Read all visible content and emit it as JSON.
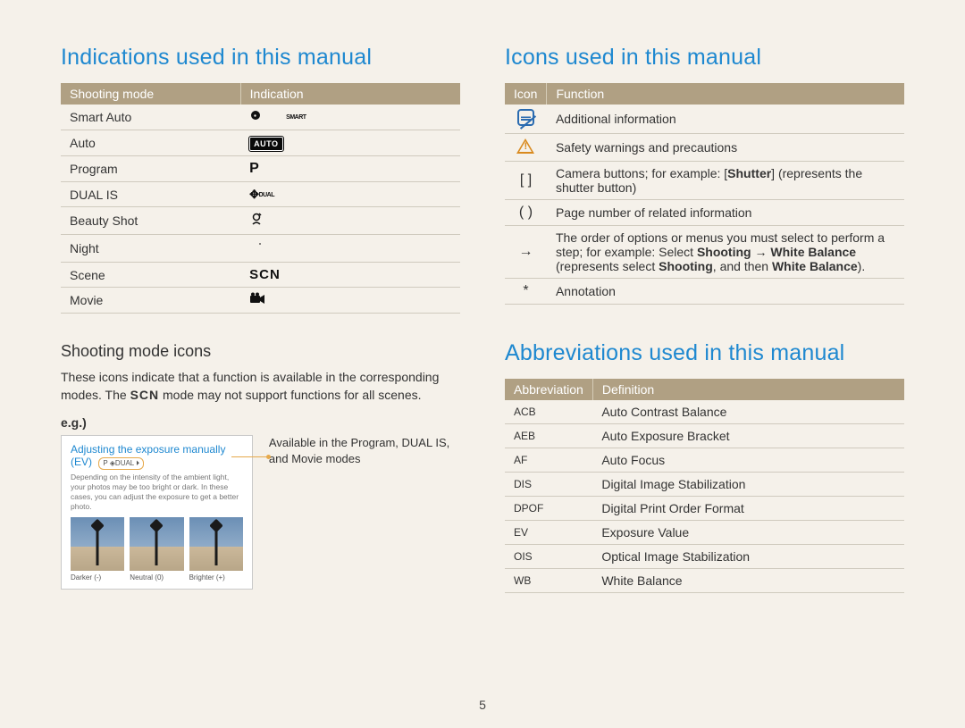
{
  "page_number": "5",
  "left": {
    "title": "Indications used in this manual",
    "table_headers": [
      "Shooting mode",
      "Indication"
    ],
    "rows": [
      {
        "mode": "Smart Auto",
        "indication_kind": "smart"
      },
      {
        "mode": "Auto",
        "indication_kind": "auto_chip",
        "indication_text": "AUTO"
      },
      {
        "mode": "Program",
        "indication_kind": "text",
        "indication_text": "P"
      },
      {
        "mode": "DUAL IS",
        "indication_kind": "dual"
      },
      {
        "mode": "Beauty Shot",
        "indication_kind": "beauty"
      },
      {
        "mode": "Night",
        "indication_kind": "night"
      },
      {
        "mode": "Scene",
        "indication_kind": "text_scn",
        "indication_text": "SCN"
      },
      {
        "mode": "Movie",
        "indication_kind": "movie"
      }
    ],
    "sub_title": "Shooting mode icons",
    "sub_desc_pre": "These icons indicate that a function is available in the corresponding modes. The ",
    "sub_desc_scn": "SCN",
    "sub_desc_post": " mode may not support functions for all scenes.",
    "eg_label": "e.g.)",
    "eg_box": {
      "title": "Adjusting the exposure manually (EV)",
      "badge": "P ◈DUAL ⏵",
      "desc": "Depending on the intensity of the ambient light, your photos may be too bright or dark. In these cases, you can adjust the exposure to get a better photo.",
      "thumbs": [
        {
          "caption": "Darker (-)"
        },
        {
          "caption": "Neutral (0)"
        },
        {
          "caption": "Brighter (+)"
        }
      ]
    },
    "eg_sidelabel": "Available in the Program, DUAL IS, and Movie modes"
  },
  "right": {
    "icons_title": "Icons used in this manual",
    "icons_headers": [
      "Icon",
      "Function"
    ],
    "icons_rows": [
      {
        "glyph": "note",
        "text": "Additional information"
      },
      {
        "glyph": "warn",
        "text": "Safety warnings and precautions"
      },
      {
        "glyph": "brackets_sq",
        "icon_text": "[ ]",
        "html": "Camera buttons; for example: [<strong>Shutter</strong>] (represents the shutter button)"
      },
      {
        "glyph": "brackets_rnd",
        "icon_text": "( )",
        "text": "Page number of related information"
      },
      {
        "glyph": "arrow",
        "icon_text": "→",
        "html": "The order of options or menus you must select to perform a step; for example: Select <strong>Shooting</strong> → <strong>White Balance</strong> (represents select <strong>Shooting</strong>, and then <strong>White Balance</strong>)."
      },
      {
        "glyph": "asterisk",
        "icon_text": "*",
        "text": "Annotation"
      }
    ],
    "abbr_title": "Abbreviations used in this manual",
    "abbr_headers": [
      "Abbreviation",
      "Definition"
    ],
    "abbr_rows": [
      {
        "abbr": "ACB",
        "def": "Auto Contrast Balance"
      },
      {
        "abbr": "AEB",
        "def": "Auto Exposure Bracket"
      },
      {
        "abbr": "AF",
        "def": "Auto Focus"
      },
      {
        "abbr": "DIS",
        "def": "Digital Image Stabilization"
      },
      {
        "abbr": "DPOF",
        "def": "Digital Print Order Format"
      },
      {
        "abbr": "EV",
        "def": "Exposure Value"
      },
      {
        "abbr": "OIS",
        "def": "Optical Image Stabilization"
      },
      {
        "abbr": "WB",
        "def": "White Balance"
      }
    ]
  }
}
